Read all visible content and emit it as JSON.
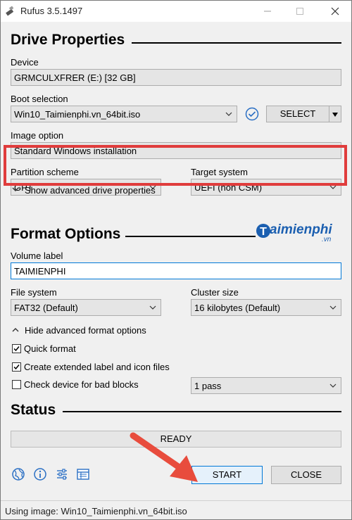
{
  "window": {
    "title": "Rufus 3.5.1497"
  },
  "drive_properties": {
    "heading": "Drive Properties",
    "device_label": "Device",
    "device_value": "GRMCULXFRER (E:) [32 GB]",
    "boot_selection_label": "Boot selection",
    "boot_selection_value": "Win10_Taimienphi.vn_64bit.iso",
    "select_button": "SELECT",
    "image_option_label": "Image option",
    "image_option_value": "Standard Windows installation",
    "partition_scheme_label": "Partition scheme",
    "partition_scheme_value": "GPT",
    "target_system_label": "Target system",
    "target_system_value": "UEFI (non CSM)",
    "advanced_toggle": "Show advanced drive properties"
  },
  "format_options": {
    "heading": "Format Options",
    "volume_label_label": "Volume label",
    "volume_label_value": "TAIMIENPHI",
    "file_system_label": "File system",
    "file_system_value": "FAT32 (Default)",
    "cluster_size_label": "Cluster size",
    "cluster_size_value": "16 kilobytes (Default)",
    "advanced_toggle": "Hide advanced format options",
    "quick_format": {
      "label": "Quick format",
      "checked": true
    },
    "extended_label": {
      "label": "Create extended label and icon files",
      "checked": true
    },
    "bad_blocks": {
      "label": "Check device for bad blocks",
      "checked": false
    },
    "passes_value": "1 pass"
  },
  "status": {
    "heading": "Status",
    "text": "READY",
    "start_button": "START",
    "close_button": "CLOSE"
  },
  "footer": {
    "text": "Using image: Win10_Taimienphi.vn_64bit.iso"
  },
  "watermark": {
    "text": "aimienphi",
    "sub": ".vn"
  },
  "icons": [
    "globe-icon",
    "info-icon",
    "settings-sliders-icon",
    "log-icon"
  ],
  "colors": {
    "highlight": "#e03c3c",
    "arrow": "#e84c3d",
    "focus": "#0078d7"
  }
}
